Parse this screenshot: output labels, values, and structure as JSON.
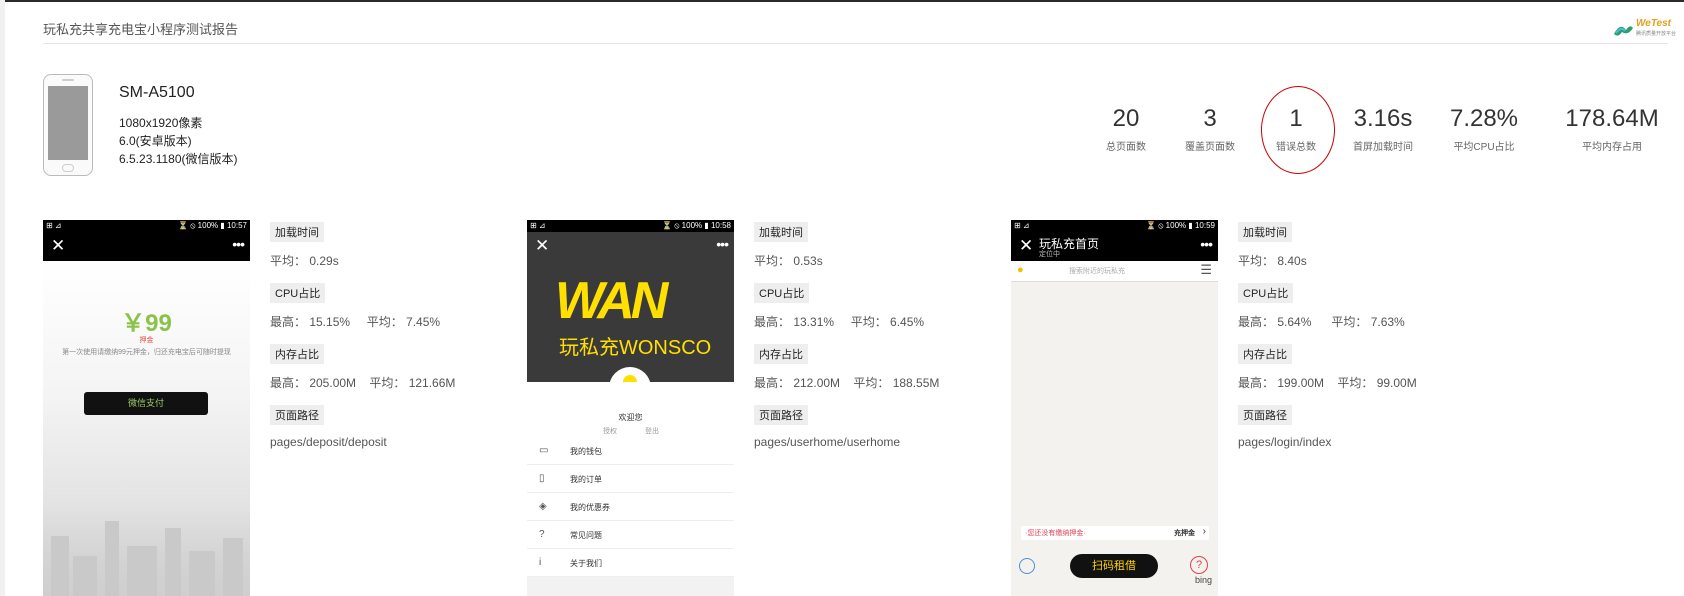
{
  "header": {
    "title": "玩私充共享充电宝小程序测试报告",
    "logo_text": "WeTest",
    "logo_sub": "腾讯质量开放平台"
  },
  "device": {
    "model": "SM-A5100",
    "resolution": "1080x1920像素",
    "android": "6.0(安卓版本)",
    "wechat": "6.5.23.1180(微信版本)"
  },
  "stats": [
    {
      "value": "20",
      "label": "总页面数"
    },
    {
      "value": "3",
      "label": "覆盖页面数"
    },
    {
      "value": "1",
      "label": "错误总数"
    },
    {
      "value": "3.16s",
      "label": "首屏加载时间"
    },
    {
      "value": "7.28%",
      "label": "平均CPU占比"
    },
    {
      "value": "178.64M",
      "label": "平均内存占用"
    }
  ],
  "labels": {
    "load": "加载时间",
    "cpu": "CPU占比",
    "mem": "内存占比",
    "path": "页面路径"
  },
  "pages": [
    {
      "status_left": "⊞ ⊿",
      "status_right": "⏳ ⦸ 100% ▮ 10:57",
      "load": "平均： 0.29s",
      "cpu": "最高： 15.15%     平均： 7.45%",
      "mem": "最高： 205.00M    平均： 121.66M",
      "path": "pages/deposit/deposit",
      "screen": {
        "price": "￥99",
        "deposit_label": "押金",
        "tip": "第一次使用请缴纳99元押金，归还充电宝后可随时提现",
        "pay_button": "微信支付"
      }
    },
    {
      "status_left": "⊞ ⊿",
      "status_right": "⏳ ⦸ 100% ▮ 10:58",
      "load": "平均： 0.53s",
      "cpu": "最高： 13.31%     平均： 6.45%",
      "mem": "最高： 212.00M    平均： 188.55M",
      "path": "pages/userhome/userhome",
      "screen": {
        "brand_logo": "WAN",
        "brand": "玩私充WONSCO",
        "welcome": "欢迎您",
        "auth": "授权",
        "logout": "登出",
        "menu": [
          {
            "icon": "▭",
            "label": "我的钱包"
          },
          {
            "icon": "▯",
            "label": "我的订单"
          },
          {
            "icon": "◈",
            "label": "我的优惠券"
          },
          {
            "icon": "?",
            "label": "常见问题"
          },
          {
            "icon": "i",
            "label": "关于我们"
          }
        ]
      }
    },
    {
      "status_left": "⊞ ⊿",
      "status_right": "⏳ ⦸ 100% ▮ 10:59",
      "load": "平均： 8.40s",
      "cpu": "最高： 5.64%      平均： 7.63%",
      "mem": "最高： 199.00M    平均： 99.00M",
      "path": "pages/login/index",
      "screen": {
        "nav_title": "玩私充首页",
        "nav_sub": "定位中",
        "search": "搜索附近的玩私充",
        "warn": "·您还没有缴纳押金·",
        "charge": "充押金",
        "scan": "扫码租借",
        "bing": "bing"
      }
    }
  ]
}
